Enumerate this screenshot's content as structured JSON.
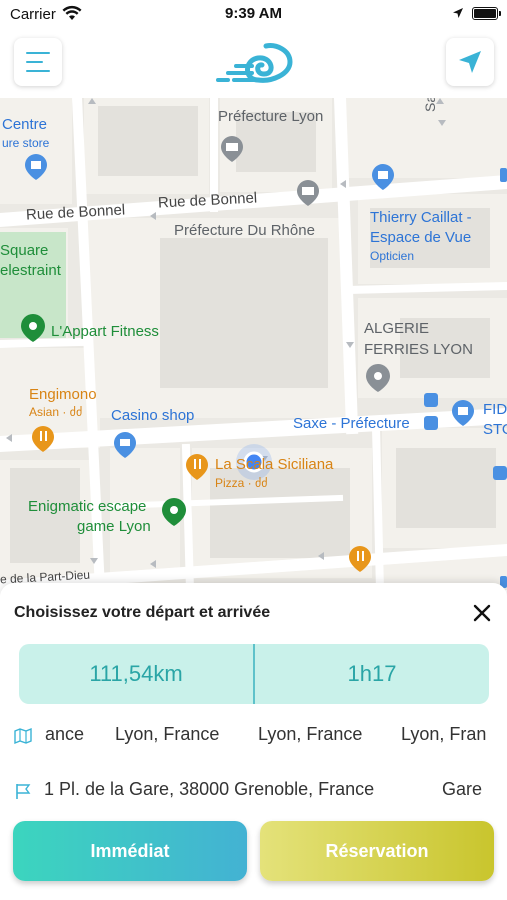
{
  "status_bar": {
    "carrier": "Carrier",
    "time": "9:39 AM"
  },
  "header": {
    "menu_icon": "hamburger-menu-icon",
    "logo_icon": "wind-spiral-logo",
    "nav_icon": "navigation-arrow-icon",
    "accent_color": "#3ab3d6"
  },
  "map": {
    "labels": {
      "centre": "Centre",
      "centre_sub": "ure store",
      "prefecture_lyon": "Préfecture Lyon",
      "saxe_vertical": "Saxe",
      "rue_bonnel_1": "Rue de Bonnel",
      "rue_bonnel_2": "Rue de Bonnel",
      "prefecture_rhone": "Préfecture Du Rhône",
      "thierry_1": "Thierry Caillat -",
      "thierry_2": "Espace de Vue",
      "thierry_sub": "Opticien",
      "square_1": "Square",
      "square_2": "elestraint",
      "appart_fitness": "L'Appart Fitness",
      "algerie_1": "ALGERIE",
      "algerie_2": "FERRIES LYON",
      "engimono": "Engimono",
      "engimono_sub": "Asian · ძძ",
      "casino": "Casino shop",
      "saxe_prefecture": "Saxe - Préfecture",
      "fid_1": "FID",
      "fid_2": "STO",
      "la_scala": "La Scala Siciliana",
      "la_scala_sub": "Pizza · ძძ",
      "escape_1": "Enigmatic escape",
      "escape_2": "game Lyon",
      "part_dieu": "e de la Part-Dieu"
    },
    "colors": {
      "land": "#ebe9e4",
      "block": "#f3f1ec",
      "building": "#e3e1dc",
      "road": "#ffffff",
      "park": "#c8e6c9",
      "user_dot": "#4285f4"
    }
  },
  "sheet": {
    "title": "Choisissez votre départ et arrivée",
    "close_icon": "close-x-icon",
    "distance": "111,54km",
    "duration": "1h17",
    "departure_icon": "map-pin-outline-icon",
    "departure_suggestions": [
      "ance",
      "Lyon, France",
      "Lyon, France",
      "Lyon, Fran"
    ],
    "arrival_icon": "flag-icon",
    "arrival_suggestions": [
      "1 Pl. de la Gare, 38000 Grenoble, France",
      "Gare"
    ],
    "btn_immediate": "Immédiat",
    "btn_reservation": "Réservation"
  }
}
